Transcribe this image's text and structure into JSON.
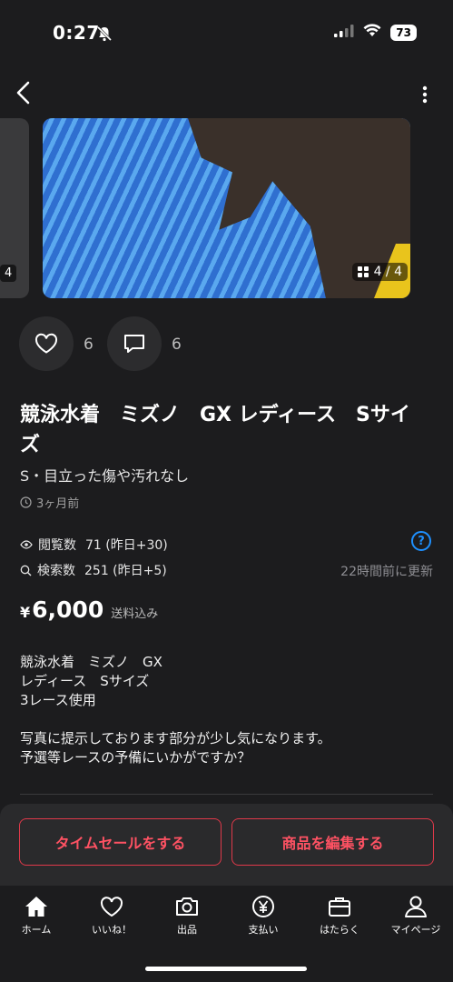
{
  "status": {
    "time": "0:27",
    "battery": "73"
  },
  "carousel": {
    "prev_counter": "4",
    "counter": "4 / 4"
  },
  "reactions": {
    "likes": "6",
    "comments": "6"
  },
  "item": {
    "title": "競泳水着　ミズノ　GX レディース　Sサイズ",
    "condition": "S・目立った傷や汚れなし",
    "posted": "3ヶ月前",
    "views_label": "閲覧数",
    "views_value": "71 (昨日+30)",
    "searches_label": "検索数",
    "searches_value": "251 (昨日+5)",
    "help": "?",
    "updated": "22時間前に更新",
    "price_symbol": "¥",
    "price": "6,000",
    "shipping": "送料込み",
    "description": [
      "競泳水着　ミズノ　GX",
      "レディース　Sサイズ",
      "3レース使用",
      "",
      "写真に提示しております部分が少し気になります。",
      "予選等レースの予備にいかがですか？"
    ]
  },
  "actions": {
    "timesale": "タイムセールをする",
    "edit": "商品を編集する"
  },
  "tabs": [
    {
      "label": "ホーム",
      "icon": "home-icon"
    },
    {
      "label": "いいね！",
      "icon": "heart-icon"
    },
    {
      "label": "出品",
      "icon": "camera-icon"
    },
    {
      "label": "支払い",
      "icon": "yen-icon"
    },
    {
      "label": "はたらく",
      "icon": "briefcase-icon"
    },
    {
      "label": "マイページ",
      "icon": "person-icon"
    }
  ],
  "colors": {
    "background": "#1c1c1e",
    "accent": "#e0394a",
    "link": "#1e90ff"
  }
}
